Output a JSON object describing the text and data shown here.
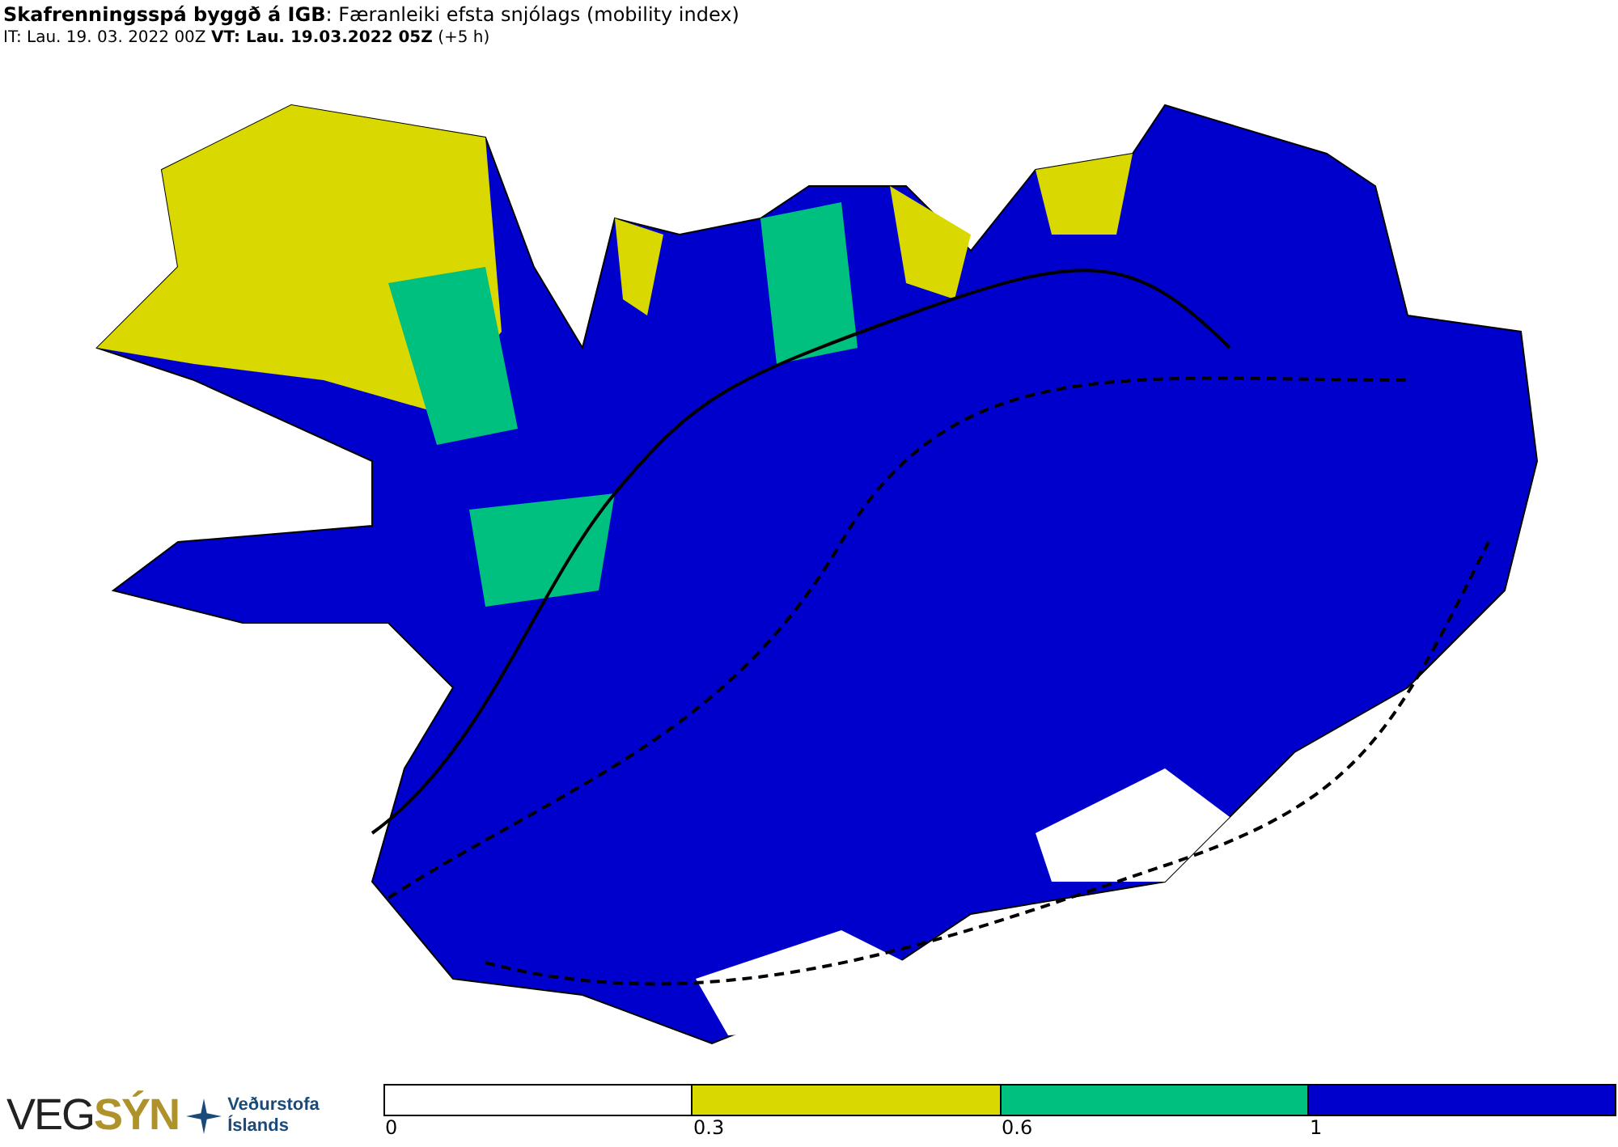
{
  "header": {
    "title": "**Skafrenningsspá byggð á IGB**: Færanleiki efsta snjólags (mobility index)",
    "times": "IT: Lau. 19. 03. 2022 00Z **VT: Lau. 19.03.2022 05Z** (+5 h)"
  },
  "logos": {
    "vegsyn": [
      "VEG",
      "SÝN"
    ],
    "vedurstofa": [
      "Veðurstofa",
      "Íslands"
    ]
  },
  "legend": {
    "segments": [
      {
        "color": "#ffffff",
        "label": "0"
      },
      {
        "color": "#d9d800",
        "label": "0.3"
      },
      {
        "color": "#00c080",
        "label": "0.6"
      },
      {
        "color": "#0000cc",
        "label": "1"
      }
    ]
  }
}
